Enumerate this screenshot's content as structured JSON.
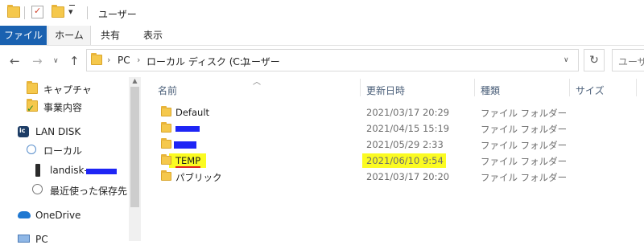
{
  "window": {
    "title": "ユーザー"
  },
  "ribbon": {
    "tabs": [
      "ファイル",
      "ホーム",
      "共有",
      "表示"
    ]
  },
  "address": {
    "crumbs": [
      "PC",
      "ローカル ディスク (C:)",
      "ユーザー"
    ],
    "search_placeholder": "ユーザ"
  },
  "nav": {
    "items": [
      {
        "label": "キャプチャ"
      },
      {
        "label": "事業内容"
      },
      {
        "label": "LAN DISK"
      },
      {
        "label": "ローカル"
      },
      {
        "label": "landisk-"
      },
      {
        "label": "最近使った保存先"
      },
      {
        "label": "OneDrive"
      },
      {
        "label": "PC"
      }
    ]
  },
  "columns": {
    "name": "名前",
    "date": "更新日時",
    "type": "種類",
    "size": "サイズ"
  },
  "files": [
    {
      "name": "Default",
      "date": "2021/03/17 20:29",
      "type": "ファイル フォルダー"
    },
    {
      "name": "",
      "date": "2021/04/15 15:19",
      "type": "ファイル フォルダー"
    },
    {
      "name": "",
      "date": "2021/05/29 2:33",
      "type": "ファイル フォルダー"
    },
    {
      "name": "TEMP",
      "date": "2021/06/10 9:54",
      "type": "ファイル フォルダー"
    },
    {
      "name": "パブリック",
      "date": "2021/03/17 20:20",
      "type": "ファイル フォルダー"
    }
  ],
  "colors": {
    "file_tab": "#1a61b0",
    "highlight": "#fbfb22",
    "redaction": "#1e25f5",
    "underline": "#e0251b"
  }
}
